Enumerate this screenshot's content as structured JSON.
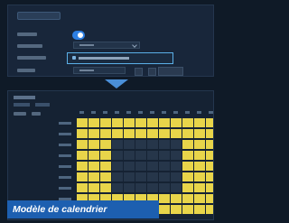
{
  "caption": {
    "text": "Modèle de calendrier"
  },
  "colors": {
    "background": "#0f1a27",
    "panel": "#18263a",
    "toggle_on": "#2d7fe3",
    "link_border": "#5bb0e8",
    "arrow": "#4a8fd8",
    "schedule_on": "#e8d54a",
    "schedule_off": "#26364a",
    "caption_bg": "#1d5fb0"
  },
  "icons": [
    "arrow-down-icon",
    "chevron-down-icon",
    "plus-icon",
    "minus-icon",
    "link-icon"
  ],
  "settings": {
    "toggle_on": true
  },
  "schedule": {
    "columns": 12,
    "rows": [
      [
        1,
        1,
        1,
        1,
        1,
        1,
        1,
        1,
        1,
        1,
        1,
        1
      ],
      [
        1,
        1,
        1,
        1,
        1,
        1,
        1,
        1,
        1,
        1,
        1,
        1
      ],
      [
        1,
        1,
        1,
        0,
        0,
        0,
        0,
        0,
        0,
        1,
        1,
        1
      ],
      [
        1,
        1,
        1,
        0,
        0,
        0,
        0,
        0,
        0,
        1,
        1,
        1
      ],
      [
        1,
        1,
        1,
        0,
        0,
        0,
        0,
        0,
        0,
        1,
        1,
        1
      ],
      [
        1,
        1,
        1,
        0,
        0,
        0,
        0,
        0,
        0,
        1,
        1,
        1
      ],
      [
        1,
        1,
        1,
        0,
        0,
        0,
        0,
        0,
        0,
        1,
        1,
        1
      ],
      [
        1,
        1,
        1,
        1,
        1,
        1,
        1,
        1,
        1,
        1,
        1,
        1
      ],
      [
        1,
        1,
        1,
        1,
        1,
        1,
        1,
        1,
        1,
        1,
        1,
        1
      ]
    ]
  }
}
